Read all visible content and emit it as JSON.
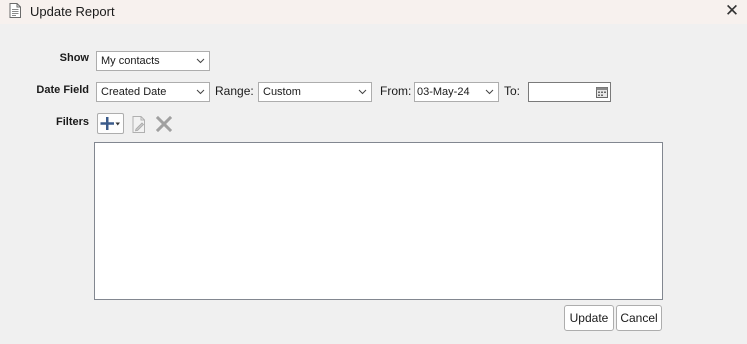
{
  "window": {
    "title": "Update Report",
    "close_symbol": "✕"
  },
  "form": {
    "show_label": "Show",
    "show_value": "My contacts",
    "date_field_label": "Date Field",
    "date_field_value": "Created Date",
    "range_label": "Range:",
    "range_value": "Custom",
    "from_label": "From:",
    "from_value": "03-May-24",
    "to_label": "To:",
    "to_value": "",
    "filters_label": "Filters"
  },
  "buttons": {
    "update_label": "Update",
    "cancel_label": "Cancel"
  },
  "icons": {
    "title": "report-document-icon",
    "add": "plus-dropdown-icon",
    "edit": "edit-document-icon",
    "delete": "delete-x-icon",
    "calendar": "calendar-icon"
  },
  "colors": {
    "add_icon": "#3a5a8a",
    "disabled_icon": "#b0b0b0",
    "titlebar_bg": "#f7f1ee"
  }
}
